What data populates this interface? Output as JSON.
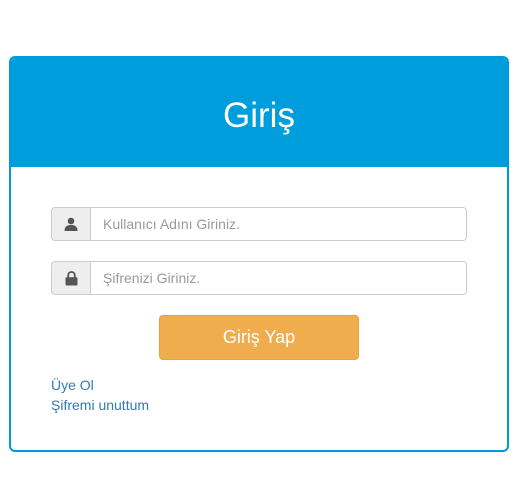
{
  "panel": {
    "title": "Giriş"
  },
  "form": {
    "username": {
      "icon": "user-icon",
      "value": "",
      "placeholder": "Kullanıcı Adını Giriniz."
    },
    "password": {
      "icon": "lock-icon",
      "value": "",
      "placeholder": "Şifrenizi Giriniz."
    },
    "submit_label": "Giriş Yap"
  },
  "links": {
    "register": "Üye Ol",
    "forgot_password": "Şifremi unuttum"
  },
  "colors": {
    "header": "#009ddc",
    "border": "#0099dc",
    "button": "#f0ad4e",
    "link": "#337ab7"
  }
}
